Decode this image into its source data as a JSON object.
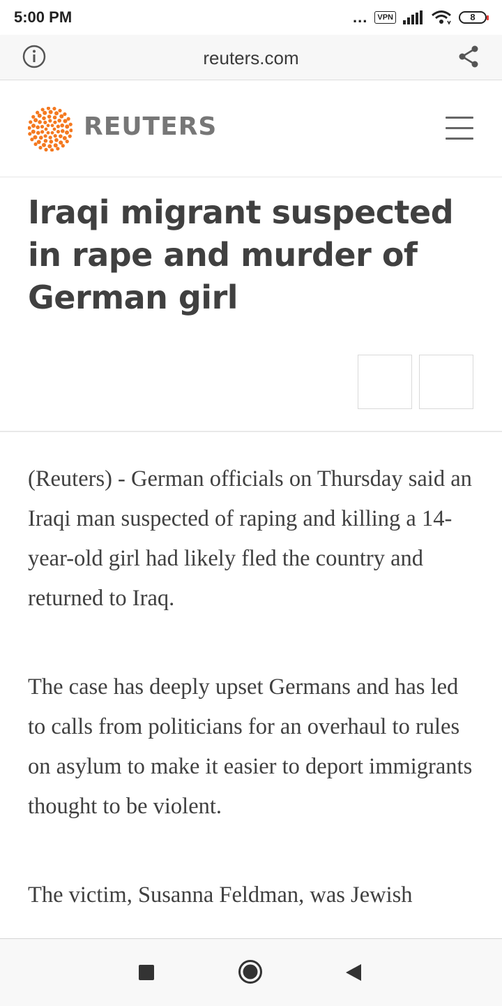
{
  "status_bar": {
    "time": "5:00 PM",
    "dots": "...",
    "vpn": "VPN",
    "battery": "8"
  },
  "browser": {
    "url": "reuters.com",
    "icons": [
      "info-icon",
      "share-icon"
    ]
  },
  "site": {
    "brand": "REUTERS",
    "brand_color": "#f47920",
    "icons": [
      "reuters-logo",
      "menu-icon"
    ]
  },
  "article": {
    "headline": "Iraqi migrant suspected in rape and murder of German girl",
    "paragraphs": [
      "(Reuters) - German officials on Thursday said an Iraqi man suspected of raping and killing a 14-year-old girl had likely fled the country and returned to Iraq.",
      "The case has deeply upset Germans and has led to calls from politicians for an overhaul to rules on asylum to make it easier to deport immigrants thought to be violent.",
      "The victim, Susanna Feldman, was Jewish"
    ]
  },
  "nav": {
    "icons": [
      "recents-square-icon",
      "home-circle-icon",
      "back-triangle-icon"
    ]
  }
}
